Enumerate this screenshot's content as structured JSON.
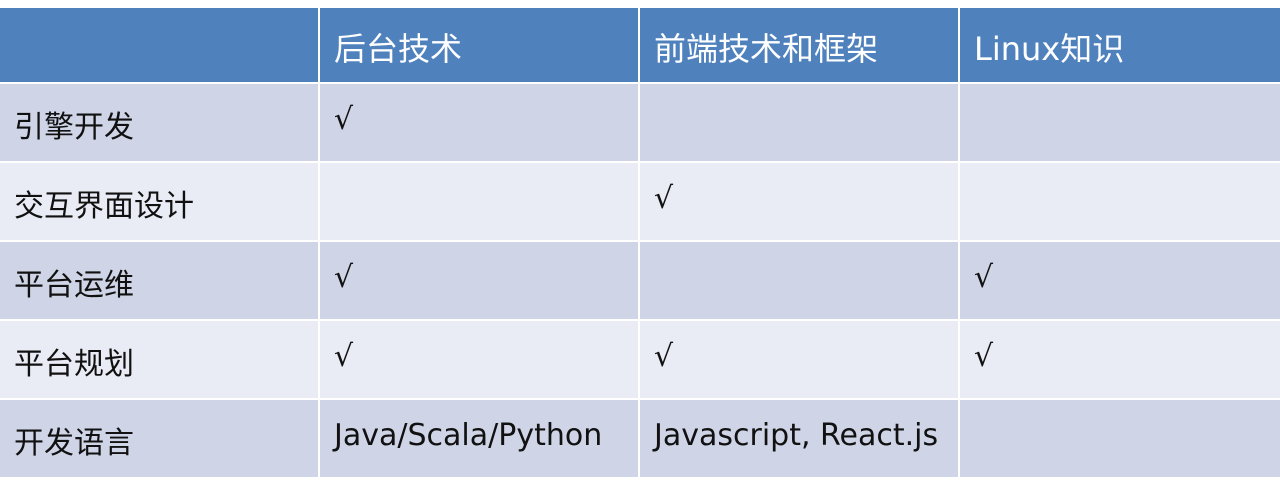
{
  "table": {
    "headers": [
      "",
      "后台技术",
      "前端技术和框架",
      "Linux知识"
    ],
    "rows": [
      [
        "引擎开发",
        "√",
        "",
        ""
      ],
      [
        "交互界面设计",
        "",
        "√",
        ""
      ],
      [
        "平台运维",
        "√",
        "",
        "√"
      ],
      [
        "平台规划",
        "√",
        "√",
        "√"
      ],
      [
        "开发语言",
        "Java/Scala/Python",
        "Javascript, React.js",
        ""
      ]
    ]
  },
  "colors": {
    "header_bg": "#4f81bd",
    "row_dark_bg": "#cfd5e7",
    "row_light_bg": "#e9ecf4"
  }
}
